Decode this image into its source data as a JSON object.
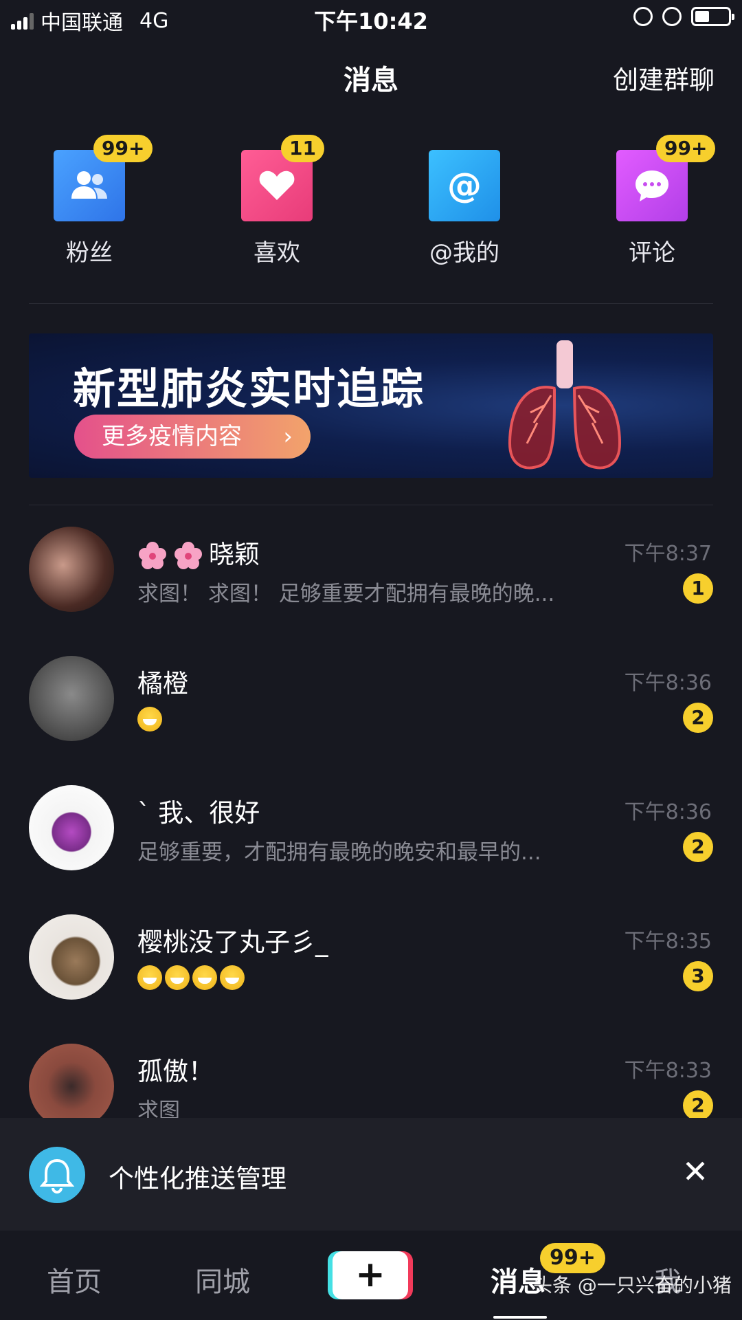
{
  "status_bar": {
    "carrier": "中国联通",
    "network": "4G",
    "time": "下午10:42"
  },
  "header": {
    "title": "消息",
    "create_group": "创建群聊"
  },
  "tiles": [
    {
      "label": "粉丝",
      "badge": "99+",
      "icon": "fans-icon",
      "color": "#3d8ef6"
    },
    {
      "label": "喜欢",
      "badge": "11",
      "icon": "heart-icon",
      "color": "#f04a84"
    },
    {
      "label": "@我的",
      "badge": "",
      "icon": "at-icon",
      "color": "#27a6ee"
    },
    {
      "label": "评论",
      "badge": "99+",
      "icon": "comment-icon",
      "color": "#c84df0"
    }
  ],
  "banner": {
    "headline": "新型肺炎实时追踪",
    "button": "更多疫情内容"
  },
  "messages": [
    {
      "name": "晓颖",
      "preview": "求图！   求图！  足够重要才配拥有最晚的晚...",
      "time": "下午8:37",
      "unread": "1"
    },
    {
      "name": "橘橙",
      "preview": "",
      "time": "下午8:36",
      "unread": "2"
    },
    {
      "name": "ˋ  我、很好",
      "preview": "足够重要，才配拥有最晚的晚安和最早的...",
      "time": "下午8:36",
      "unread": "2"
    },
    {
      "name": "樱桃没了丸子彡_",
      "preview": "",
      "time": "下午8:35",
      "unread": "3"
    },
    {
      "name": "孤傲！",
      "preview": "求图",
      "time": "下午8:33",
      "unread": "2"
    }
  ],
  "push_bar": {
    "label": "个性化推送管理"
  },
  "tabbar": {
    "home": "首页",
    "local": "同城",
    "messages": "消息",
    "messages_badge": "99+",
    "me": "我"
  },
  "watermark": "头条 @一只兴奋的小猪"
}
